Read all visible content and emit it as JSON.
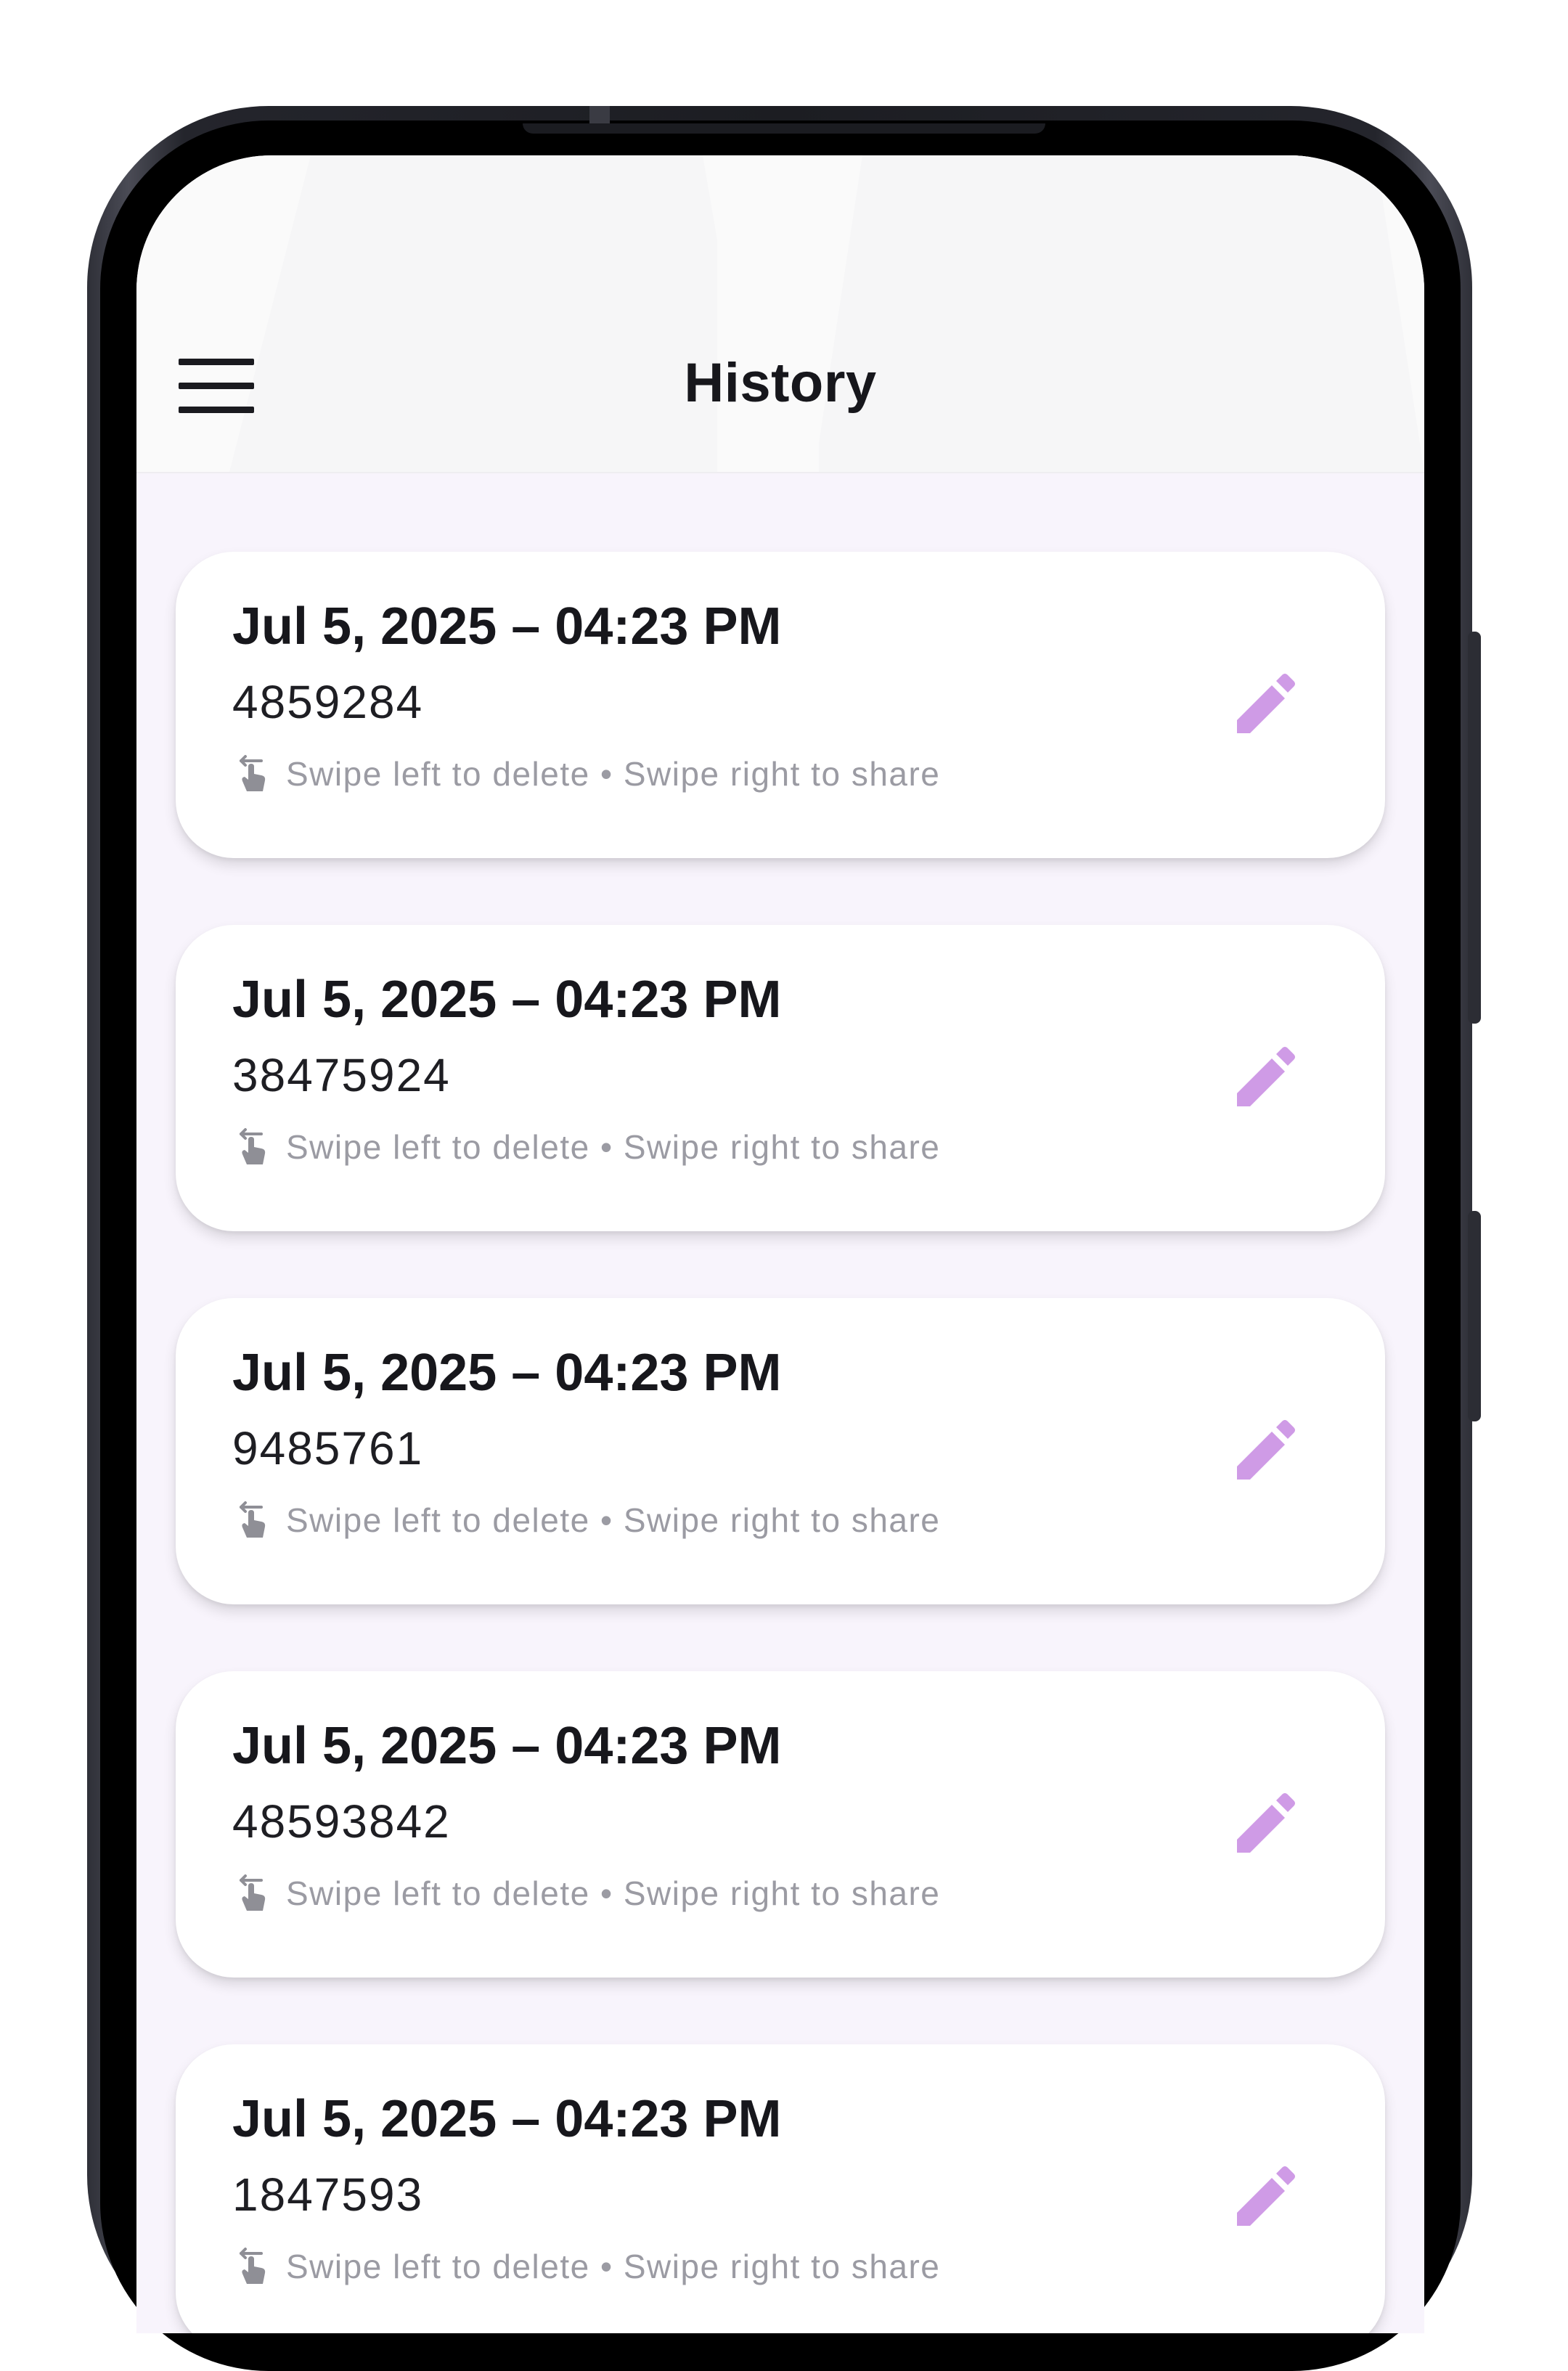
{
  "header": {
    "title": "History"
  },
  "colors": {
    "accent": "#cf9be6",
    "background": "#f8f4fc",
    "card": "#ffffff",
    "text": "#17171c",
    "hint": "#9b9ba3"
  },
  "history": {
    "items": [
      {
        "date": "Jul 5, 2025 – 04:23 PM",
        "number": "4859284",
        "hint": "Swipe left to delete • Swipe right to share",
        "hint_icon": "swipe-gesture-icon",
        "action_icon": "pencil-edit-icon"
      },
      {
        "date": "Jul 5, 2025 – 04:23 PM",
        "number": "38475924",
        "hint": "Swipe left to delete • Swipe right to share",
        "hint_icon": "swipe-gesture-icon",
        "action_icon": "pencil-edit-icon"
      },
      {
        "date": "Jul 5, 2025 – 04:23 PM",
        "number": "9485761",
        "hint": "Swipe left to delete • Swipe right to share",
        "hint_icon": "swipe-gesture-icon",
        "action_icon": "pencil-edit-icon"
      },
      {
        "date": "Jul 5, 2025 – 04:23 PM",
        "number": "48593842",
        "hint": "Swipe left to delete • Swipe right to share",
        "hint_icon": "swipe-gesture-icon",
        "action_icon": "pencil-edit-icon"
      },
      {
        "date": "Jul 5, 2025 – 04:23 PM",
        "number": "1847593",
        "hint": "Swipe left to delete • Swipe right to share",
        "hint_icon": "swipe-gesture-icon",
        "action_icon": "pencil-edit-icon"
      }
    ]
  }
}
